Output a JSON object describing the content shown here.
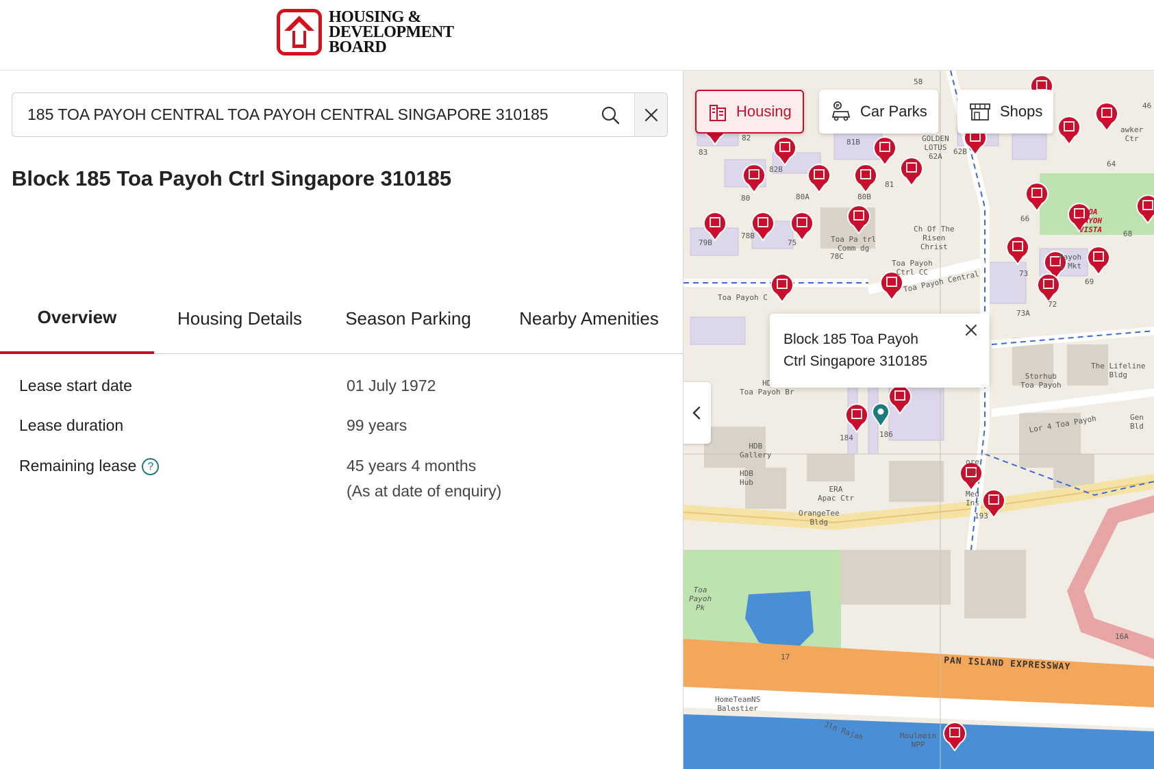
{
  "header": {
    "logo_text": [
      "HOUSING &",
      "DEVELOPMENT",
      "BOARD"
    ]
  },
  "search": {
    "value": "185 TOA PAYOH CENTRAL TOA PAYOH CENTRAL SINGAPORE 310185",
    "search_icon": "search-icon",
    "clear_icon": "close-icon"
  },
  "block_title": "Block 185 Toa Payoh Ctrl Singapore 310185",
  "tabs": [
    {
      "label": "Overview",
      "active": true
    },
    {
      "label": "Housing Details",
      "active": false
    },
    {
      "label": "Season Parking",
      "active": false
    },
    {
      "label": "Nearby Amenities",
      "active": false
    }
  ],
  "lease": {
    "start_label": "Lease start date",
    "start_value": "01 July 1972",
    "duration_label": "Lease duration",
    "duration_value": "99 years",
    "remaining_label": "Remaining lease",
    "remaining_help": "?",
    "remaining_value": "45 years 4 months",
    "remaining_note": "(As at date of enquiry)"
  },
  "map": {
    "chips": [
      {
        "label": "Housing",
        "icon": "building-icon",
        "active": true
      },
      {
        "label": "Car Parks",
        "icon": "car-park-icon",
        "active": false
      },
      {
        "label": "Shops",
        "icon": "shop-icon",
        "active": false
      }
    ],
    "popup": {
      "line1": "Block 185 Toa Payoh",
      "line2": "Ctrl Singapore 310185"
    },
    "labels": {
      "golden_lotus": "GOLDEN\nLOTUS\n62A",
      "toa_payoh_vista": "TOA\nPAYOH\nVISTA",
      "ch_risen_christ": "Ch Of The\nRisen\nChrist",
      "toa_payoh_ctrl_cc": "Toa Payoh\nCtrl CC",
      "toa_payoh_central_road": "Toa Payoh Central",
      "toa_payoh_road": "Toa Payoh C",
      "toa_payoh_comm": "Toa Pa    trl\nComm    dg",
      "hawker_ctr": "awker\nCtr",
      "payoh_mkt": "Payoh\na Mkt",
      "the_lifeline": "The Lifeline\nBldg",
      "storhub": "Storhub\nToa Payoh",
      "lor4": "Lor 4 Toa Payoh",
      "gen_bldg": "Gen\nBld",
      "hdb_gallery": "HDB\nGallery",
      "hdb_hub": "HDB\nHub",
      "toa_payoh_br": "HD\nToa Payoh Br",
      "era": "ERA\nApac Ctr",
      "orangetee": "OrangeTee\nBldg",
      "toa_payoh_pk": "Toa\nPayoh\nPk",
      "pie": "PAN ISLAND EXPRESSWAY",
      "hometeamns": "HomeTeamNS\nBalestier",
      "jln_rajah": "Jln Rajah",
      "moulmein": "Moulmein\nNPP",
      "blk_82": "82",
      "blk_83": "83",
      "blk_82b": "82B",
      "blk_80": "80",
      "blk_80a": "80A",
      "blk_80b": "80B",
      "blk_81": "81",
      "blk_81b": "81B",
      "blk_62b": "62B",
      "blk_64": "64",
      "blk_66": "66",
      "blk_68": "68",
      "blk_73": "73",
      "blk_73a": "73A",
      "blk_72": "72",
      "blk_69": "69",
      "blk_79b": "79B",
      "blk_78b": "78B",
      "blk_78c": "78C",
      "blk_75": "75",
      "blk_184": "184",
      "blk_186": "186",
      "blk_193": "193",
      "blk_16a": "16A",
      "blk_17": "17",
      "blk_58": "58",
      "blk_46": "46",
      "med_ins": "Med\nIns",
      "ng_ore": "ore\nng\nw"
    }
  },
  "colors": {
    "brand_red": "#c8102e",
    "teal": "#1f7a80",
    "expressway": "#f3a75a",
    "park": "#bfe3b0",
    "water": "#4a8fd6"
  }
}
